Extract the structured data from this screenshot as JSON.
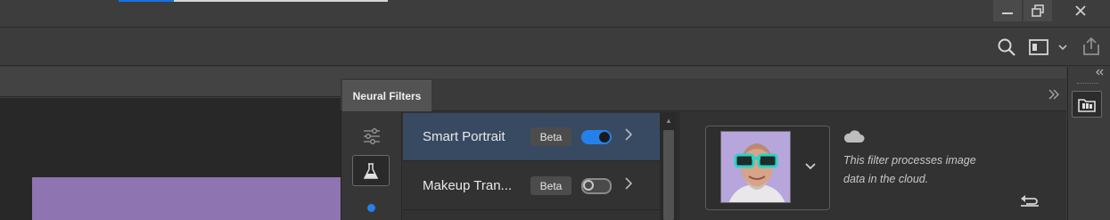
{
  "window": {
    "minimize_icon": "minimize-icon",
    "restore_icon": "restore-icon",
    "close_icon": "close-icon"
  },
  "toolbar": {
    "search_icon": "search-icon",
    "workspace_icon": "workspace-icon",
    "share_icon": "share-icon"
  },
  "neural_filters": {
    "tab_label": "Neural Filters",
    "filters": [
      {
        "name": "Smart Portrait",
        "badge": "Beta",
        "enabled": true
      },
      {
        "name": "Makeup Tran...",
        "badge": "Beta",
        "enabled": false
      }
    ],
    "cloud_notice": "This filter processes image data in the cloud."
  },
  "colors": {
    "accent": "#2680eb",
    "selected_row": "#384a62",
    "document_fill": "#8e74b0"
  }
}
